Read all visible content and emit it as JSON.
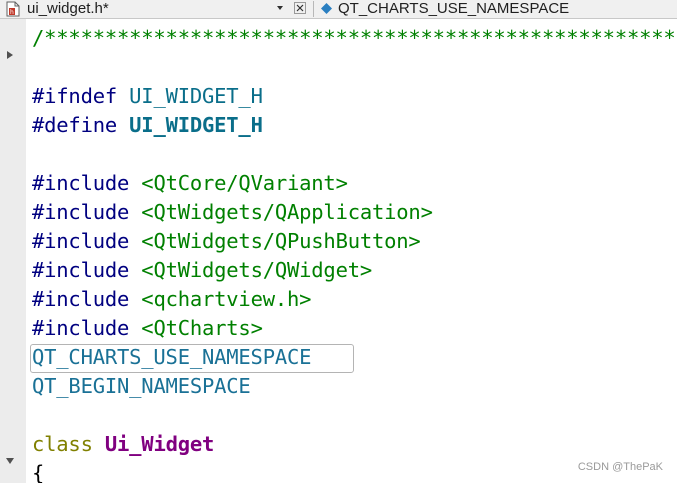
{
  "tab": {
    "file_name": "ui_widget.h*",
    "symbol_name": "QT_CHARTS_USE_NAMESPACE"
  },
  "icons": {
    "file": "header-file-icon",
    "dropdown": "chevron-down-icon",
    "close": "close-icon",
    "symbol": "diamond-symbol-icon",
    "fold_collapsed": "fold-arrow-right-icon",
    "fold_expanded": "fold-arrow-down-icon"
  },
  "code": {
    "line1": "/*****************************************************",
    "line3_directive": "#ifndef",
    "line3_macro": "UI_WIDGET_H",
    "line4_directive": "#define",
    "line4_macro": "UI_WIDGET_H",
    "include_directive": "#include",
    "include1": "<QtCore/QVariant>",
    "include2": "<QtWidgets/QApplication>",
    "include3": "<QtWidgets/QPushButton>",
    "include4": "<QtWidgets/QWidget>",
    "include5": "<qchartview.h>",
    "include6": "<QtCharts>",
    "use_namespace": "QT_CHARTS_USE_NAMESPACE",
    "begin_namespace": "QT_BEGIN_NAMESPACE",
    "class_keyword": "class",
    "class_name": "Ui_Widget",
    "open_brace": "{"
  },
  "watermark": "CSDN @ThePaK",
  "colors": {
    "comment": "#008000",
    "directive": "#000080",
    "macro": "#0a6e8a",
    "keyword": "#808000",
    "class_name": "#800080"
  }
}
